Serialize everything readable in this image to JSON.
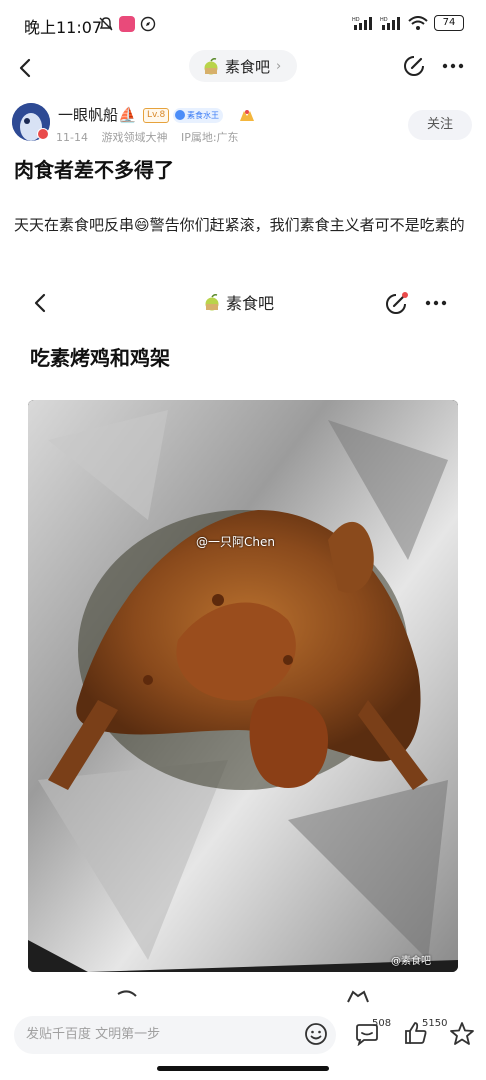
{
  "status_bar": {
    "time": "晚上11:07",
    "battery": "74",
    "network_labels": [
      "HD",
      "HD"
    ]
  },
  "topnav": {
    "forum_name": "素食吧",
    "forum_icon": "apple-emoji-icon"
  },
  "author": {
    "name": "一眼帆船⛵",
    "level": "Lv.8",
    "title": "素食水王",
    "date": "11-14",
    "tag": "游戏领域大神",
    "ip": "IP属地:广东",
    "follow_label": "关注"
  },
  "post": {
    "title": "肉食者差不多得了",
    "body": "天天在素食吧反串😄警告你们赶紧滚，我们素食主义者可不是吃素的"
  },
  "embedded": {
    "forum_name": "素食吧",
    "title": "吃素烤鸡和鸡架",
    "watermark_top": "@一只阿Chen",
    "watermark_bottom": "@素食吧"
  },
  "bottom_bar": {
    "comment_placeholder": "发贴千百度 文明第一步",
    "comment_count": "508",
    "like_count": "5150"
  },
  "colors": {
    "accent_blue": "#3b7cf5",
    "level_orange": "#d8892b",
    "badge_red": "#e94a4a"
  }
}
